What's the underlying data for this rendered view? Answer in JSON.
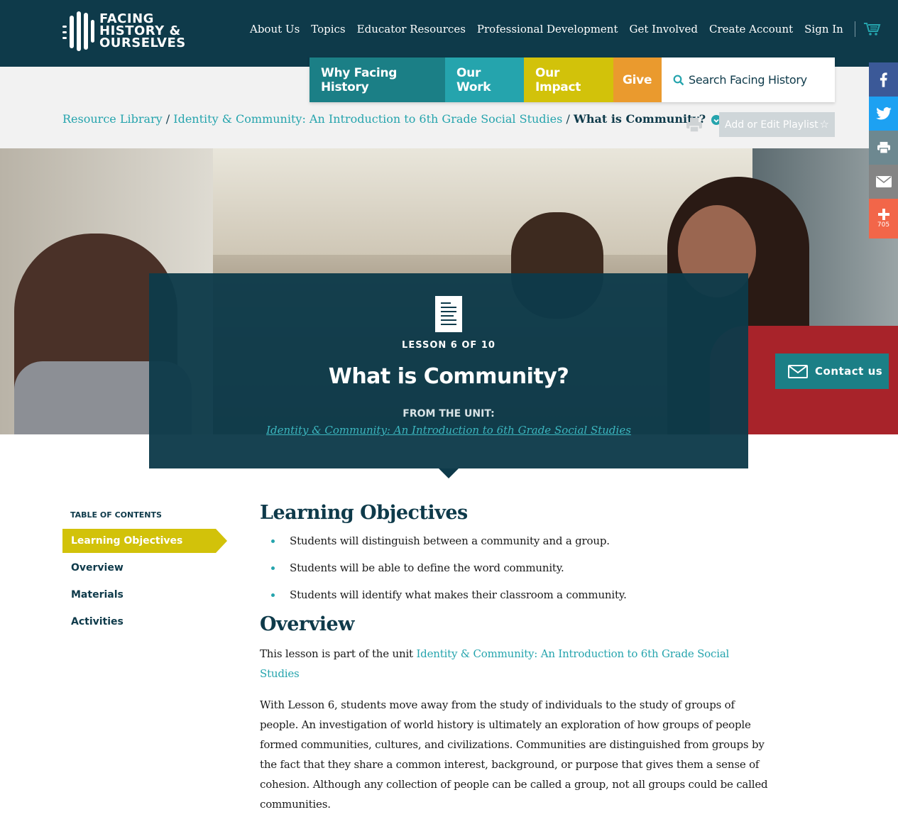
{
  "logo": {
    "line1": "FACING",
    "line2": "HISTORY &",
    "line3": "OURSELVES"
  },
  "topnav": [
    "About Us",
    "Topics",
    "Educator Resources",
    "Professional Development",
    "Get Involved",
    "Create Account",
    "Sign In"
  ],
  "subnav": {
    "why": "Why Facing History",
    "work": "Our Work",
    "impact": "Our Impact",
    "give": "Give",
    "search_placeholder": "Search Facing History"
  },
  "breadcrumb": {
    "c1": "Resource Library",
    "sep": "/",
    "c2": "Identity & Community: An Introduction to 6th Grade Social Studies",
    "current": "What is Community?"
  },
  "playlist": {
    "label": "Add or Edit Playlist"
  },
  "share": {
    "count": "705"
  },
  "contact": {
    "label": "Contact us"
  },
  "lesson": {
    "counter": "LESSON 6 OF 10",
    "title": "What is Community?",
    "from_label": "FROM THE UNIT:",
    "unit_link": "Identity & Community: An Introduction to 6th Grade Social Studies"
  },
  "toc": {
    "title": "TABLE OF CONTENTS",
    "items": [
      "Learning Objectives",
      "Overview",
      "Materials",
      "Activities"
    ]
  },
  "content": {
    "objectives_heading": "Learning Objectives",
    "objectives": [
      "Students will distinguish between a community and a group.",
      "Students will be able to define the word community.",
      "Students will identify what makes their classroom a community."
    ],
    "overview_heading": "Overview",
    "overview_intro": "This lesson is part of the unit ",
    "overview_link": "Identity & Community: An Introduction to 6th Grade Social Studies",
    "overview_body": "With Lesson 6, students move away from the study of individuals to the study of groups of people. An investigation of world history is ultimately an exploration of how groups of people formed communities, cultures, and civilizations. Communities are distinguished from groups by the fact that they share a common interest, background, or purpose that gives them a sense of cohesion. Although any collection of people can be called a group, not all groups could be called communities."
  },
  "colors": {
    "navy": "#0e3a4a",
    "teal": "#25a4ad",
    "dark_teal": "#1b7f86",
    "yellow": "#d2c20a",
    "orange": "#ea9a2e"
  }
}
